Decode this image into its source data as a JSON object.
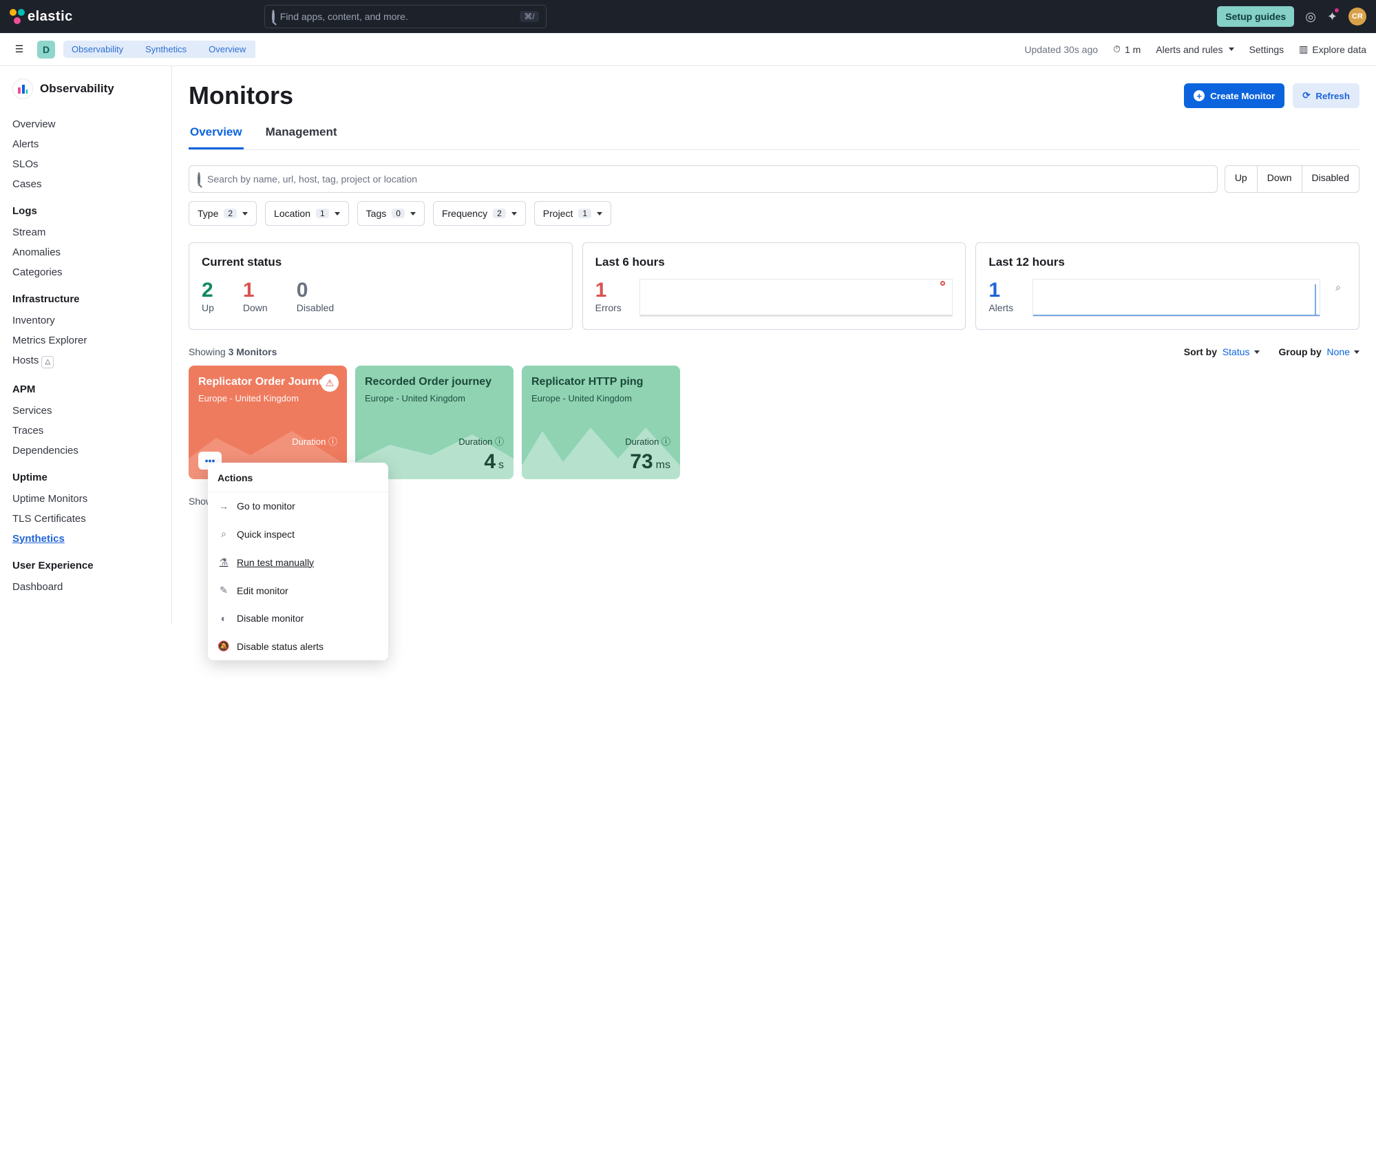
{
  "top": {
    "brand": "elastic",
    "search_placeholder": "Find apps, content, and more.",
    "kbd": "⌘/",
    "setup_guides": "Setup guides",
    "avatar_initials": "CR"
  },
  "subbar": {
    "space_initial": "D",
    "crumbs": [
      "Observability",
      "Synthetics",
      "Overview"
    ],
    "updated": "Updated 30s ago",
    "interval": "1 m",
    "alerts": "Alerts and rules",
    "settings": "Settings",
    "explore": "Explore data"
  },
  "sidebar": {
    "title": "Observability",
    "groups": [
      {
        "header": null,
        "items": [
          "Overview",
          "Alerts",
          "SLOs",
          "Cases"
        ]
      },
      {
        "header": "Logs",
        "items": [
          "Stream",
          "Anomalies",
          "Categories"
        ]
      },
      {
        "header": "Infrastructure",
        "items": [
          "Inventory",
          "Metrics Explorer",
          "Hosts"
        ]
      },
      {
        "header": "APM",
        "items": [
          "Services",
          "Traces",
          "Dependencies"
        ]
      },
      {
        "header": "Uptime",
        "items": [
          "Uptime Monitors",
          "TLS Certificates",
          "Synthetics"
        ]
      },
      {
        "header": "User Experience",
        "items": [
          "Dashboard"
        ]
      }
    ],
    "active": "Synthetics"
  },
  "header": {
    "title": "Monitors",
    "create": "Create Monitor",
    "refresh": "Refresh"
  },
  "tabs": {
    "active": "Overview",
    "items": [
      "Overview",
      "Management"
    ]
  },
  "search": {
    "placeholder": "Search by name, url, host, tag, project or location",
    "segments": [
      "Up",
      "Down",
      "Disabled"
    ]
  },
  "filters": [
    {
      "label": "Type",
      "count": "2"
    },
    {
      "label": "Location",
      "count": "1"
    },
    {
      "label": "Tags",
      "count": "0"
    },
    {
      "label": "Frequency",
      "count": "2"
    },
    {
      "label": "Project",
      "count": "1"
    }
  ],
  "stats": {
    "current": {
      "title": "Current status",
      "up": "2",
      "up_l": "Up",
      "down": "1",
      "down_l": "Down",
      "disabled": "0",
      "disabled_l": "Disabled"
    },
    "last6": {
      "title": "Last 6 hours",
      "errors": "1",
      "errors_l": "Errors"
    },
    "last12": {
      "title": "Last 12 hours",
      "alerts": "1",
      "alerts_l": "Alerts"
    }
  },
  "list": {
    "showing_prefix": "Showing ",
    "showing_value": "3 Monitors",
    "sort_label": "Sort by",
    "sort_value": "Status",
    "group_label": "Group by",
    "group_value": "None",
    "footer_showing": "Showing"
  },
  "monitors": [
    {
      "name": "Replicator Order Journey",
      "location": "Europe - United Kingdom",
      "status": "down",
      "duration_label": "Duration",
      "value": "",
      "unit": ""
    },
    {
      "name": "Recorded Order journey",
      "location": "Europe - United Kingdom",
      "status": "up",
      "duration_label": "Duration",
      "value": "4",
      "unit": "s"
    },
    {
      "name": "Replicator HTTP ping",
      "location": "Europe - United Kingdom",
      "status": "up",
      "duration_label": "Duration",
      "value": "73",
      "unit": "ms"
    }
  ],
  "popover": {
    "title": "Actions",
    "items": [
      "Go to monitor",
      "Quick inspect",
      "Run test manually",
      "Edit monitor",
      "Disable monitor",
      "Disable status alerts"
    ],
    "hover_index": 2
  }
}
